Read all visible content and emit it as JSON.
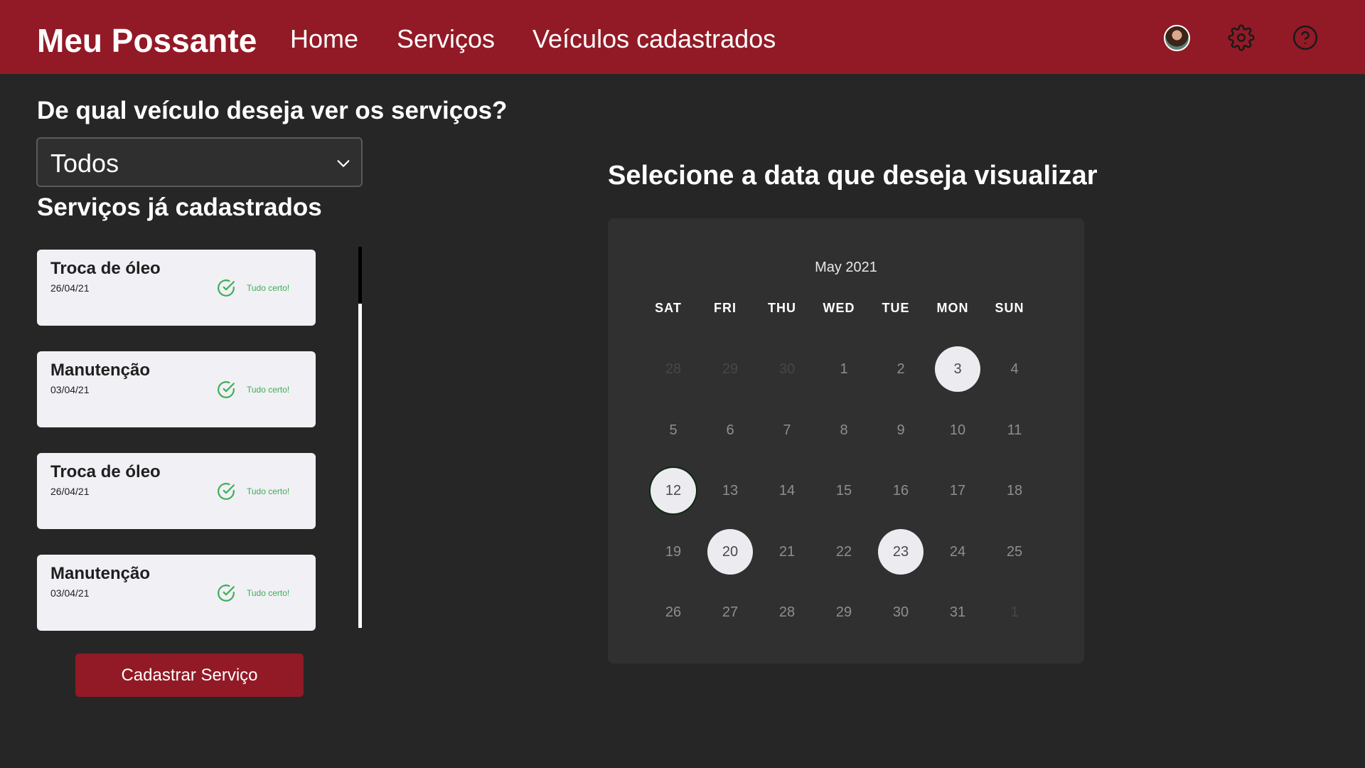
{
  "header": {
    "brand": "Meu Possante",
    "nav": {
      "home": "Home",
      "servicos": "Serviços",
      "veiculos": "Veículos cadastrados"
    },
    "icons": [
      "avatar",
      "gear-icon",
      "help-icon"
    ]
  },
  "filter": {
    "question": "De qual veículo deseja ver os serviços?",
    "selected": "Todos"
  },
  "services": {
    "title": "Serviços já cadastrados",
    "items": [
      {
        "name": "Troca de óleo",
        "date": "26/04/21",
        "status": "Tudo certo!"
      },
      {
        "name": "Manutenção",
        "date": "03/04/21",
        "status": "Tudo certo!"
      },
      {
        "name": "Troca de óleo",
        "date": "26/04/21",
        "status": "Tudo certo!"
      },
      {
        "name": "Manutenção",
        "date": "03/04/21",
        "status": "Tudo certo!"
      }
    ],
    "button": "Cadastrar Serviço"
  },
  "calendar": {
    "heading": "Selecione a data que deseja visualizar",
    "month": "May 2021",
    "weekdays": [
      "SAT",
      "FRI",
      "THU",
      "WED",
      "TUE",
      "MON",
      "SUN"
    ],
    "weeks": [
      [
        {
          "d": "28",
          "muted": true
        },
        {
          "d": "29",
          "muted": true
        },
        {
          "d": "30",
          "muted": true
        },
        {
          "d": "1"
        },
        {
          "d": "2"
        },
        {
          "d": "3",
          "highlight": true
        },
        {
          "d": "4"
        }
      ],
      [
        {
          "d": "5"
        },
        {
          "d": "6"
        },
        {
          "d": "7"
        },
        {
          "d": "8"
        },
        {
          "d": "9"
        },
        {
          "d": "10"
        },
        {
          "d": "11"
        }
      ],
      [
        {
          "d": "12",
          "selected": true
        },
        {
          "d": "13"
        },
        {
          "d": "14"
        },
        {
          "d": "15"
        },
        {
          "d": "16"
        },
        {
          "d": "17"
        },
        {
          "d": "18"
        }
      ],
      [
        {
          "d": "19"
        },
        {
          "d": "20",
          "highlight": true
        },
        {
          "d": "21"
        },
        {
          "d": "22"
        },
        {
          "d": "23",
          "highlight": true
        },
        {
          "d": "24"
        },
        {
          "d": "25"
        }
      ],
      [
        {
          "d": "26"
        },
        {
          "d": "27"
        },
        {
          "d": "28"
        },
        {
          "d": "29"
        },
        {
          "d": "30"
        },
        {
          "d": "31"
        },
        {
          "d": "1",
          "muted": true
        }
      ]
    ]
  },
  "colors": {
    "brand": "#921a26",
    "background": "#262626",
    "success": "#3fae53"
  }
}
